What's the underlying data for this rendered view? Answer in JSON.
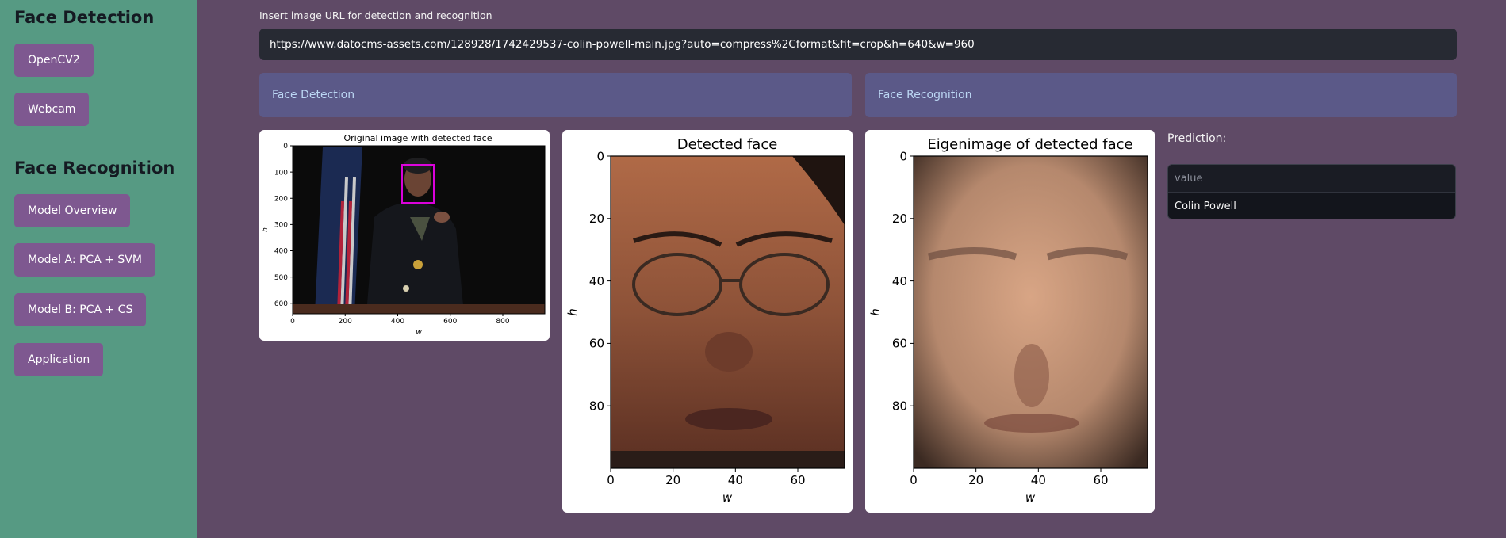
{
  "sidebar": {
    "detection_title": "Face Detection",
    "detection_items": [
      "OpenCV2",
      "Webcam"
    ],
    "recognition_title": "Face Recognition",
    "recognition_items": [
      "Model Overview",
      "Model A: PCA + SVM",
      "Model B: PCA + CS",
      "Application"
    ]
  },
  "url": {
    "label": "Insert image URL for detection and recognition",
    "value": "https://www.datocms-assets.com/128928/1742429537-colin-powell-main.jpg?auto=compress%2Cformat&fit=crop&h=640&w=960"
  },
  "tabs": [
    "Face Detection",
    "Face Recognition"
  ],
  "prediction": {
    "label": "Prediction:",
    "column": "value",
    "value": "Colin Powell"
  },
  "colors": {
    "sidebar_bg": "#569a83",
    "main_bg": "#5f4a66",
    "button_bg": "#7e5890",
    "tab_bg": "#5b5988",
    "input_bg": "#272a33"
  },
  "chart_data": [
    {
      "type": "image",
      "title": "Original image with detected face",
      "xlabel": "w",
      "ylabel": "h",
      "xlim": [
        0,
        960
      ],
      "ylim": [
        640,
        0
      ],
      "xticks": [
        0,
        200,
        400,
        600,
        800
      ],
      "yticks": [
        0,
        100,
        200,
        300,
        400,
        500,
        600
      ]
    },
    {
      "type": "image",
      "title": "Detected face",
      "xlabel": "w",
      "ylabel": "h",
      "xlim": [
        0,
        75
      ],
      "ylim": [
        100,
        0
      ],
      "xticks": [
        0,
        20,
        40,
        60
      ],
      "yticks": [
        0,
        20,
        40,
        60,
        80
      ]
    },
    {
      "type": "image",
      "title": "Eigenimage of detected face",
      "xlabel": "w",
      "ylabel": "h",
      "xlim": [
        0,
        75
      ],
      "ylim": [
        100,
        0
      ],
      "xticks": [
        0,
        20,
        40,
        60
      ],
      "yticks": [
        0,
        20,
        40,
        60,
        80
      ]
    }
  ]
}
